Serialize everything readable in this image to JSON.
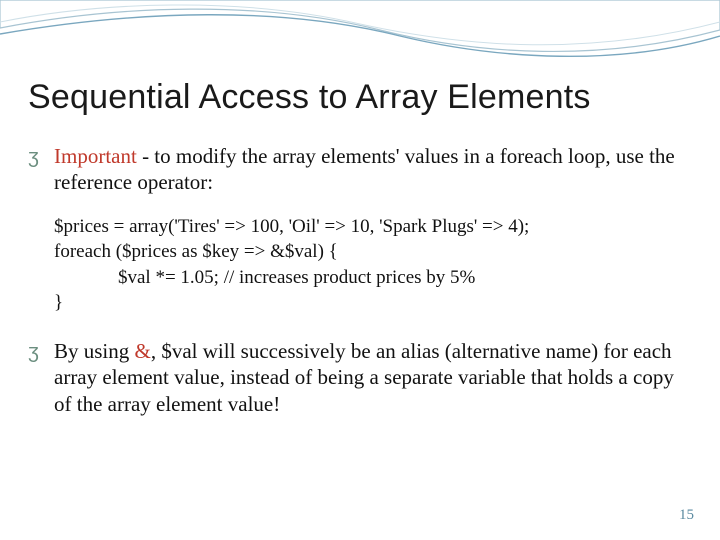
{
  "page_number": "15",
  "title": "Sequential Access to Array Elements",
  "bullets": [
    {
      "important_word": "Important",
      "rest": " - to modify the array elements' values in a foreach loop, use the reference operator:"
    },
    {
      "prefix": "By using ",
      "amp": "&",
      "suffix": ", $val will successively be an alias (alternative name) for each array element value, instead of being a separate variable that holds a copy of the array element value!"
    }
  ],
  "code": {
    "l1": "$prices = array('Tires' => 100, 'Oil' => 10, 'Spark Plugs' => 4);",
    "l2": "foreach ($prices as $key => &$val) {",
    "l3": "$val *= 1.05; // increases product prices by 5%",
    "l4": "}"
  },
  "bullet_marker": "ʒ"
}
